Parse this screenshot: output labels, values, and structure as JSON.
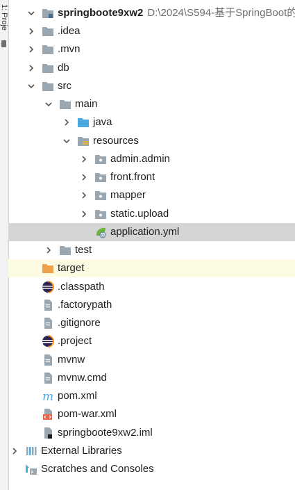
{
  "side_panel": {
    "label": "1: Proje"
  },
  "tree": {
    "root": {
      "label": "springboote9xw2",
      "path": "D:\\2024\\S594-基于SpringBoot的"
    },
    "idea": ".idea",
    "mvn": ".mvn",
    "db": "db",
    "src": "src",
    "main": "main",
    "java": "java",
    "resources": "resources",
    "admin": "admin.admin",
    "front": "front.front",
    "mapper": "mapper",
    "static_upload": "static.upload",
    "application_yml": "application.yml",
    "test": "test",
    "target": "target",
    "classpath": ".classpath",
    "factorypath": ".factorypath",
    "gitignore": ".gitignore",
    "project": ".project",
    "mvnw": "mvnw",
    "mvnw_cmd": "mvnw.cmd",
    "pom_xml": "pom.xml",
    "pom_war": "pom-war.xml",
    "iml": "springboote9xw2.iml",
    "external_libraries": "External Libraries",
    "scratches": "Scratches and Consoles"
  },
  "colors": {
    "selection": "#d5d5d5",
    "excluded_bg": "#fdfce3",
    "folder": "#9aa7b0",
    "source_folder": "#4ca9e0",
    "target_folder": "#f0a04b",
    "spring_green": "#6db33f"
  }
}
